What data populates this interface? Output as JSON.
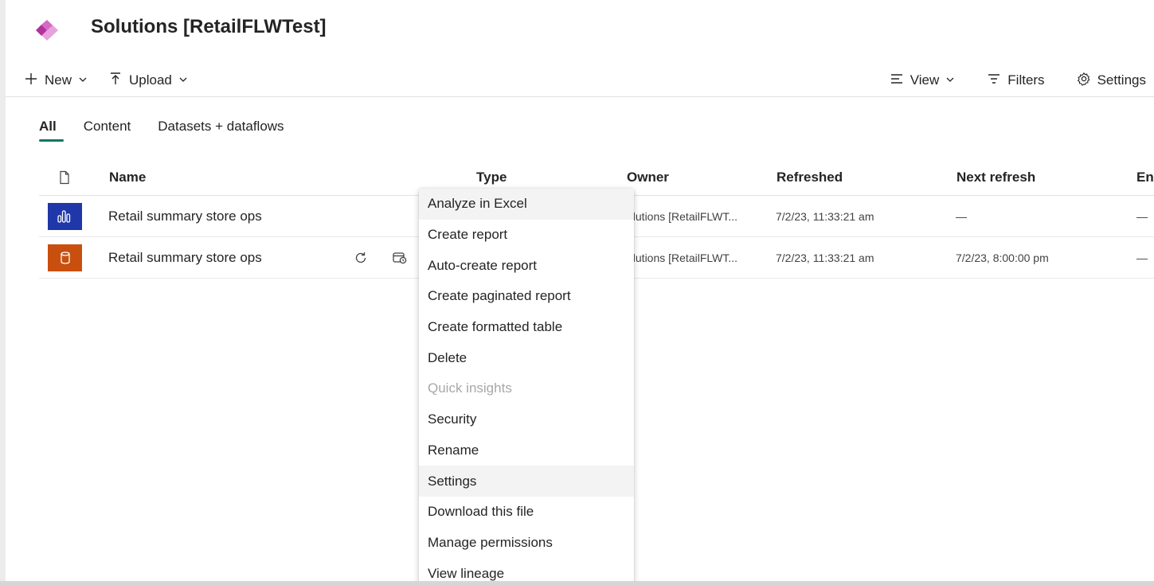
{
  "window": {
    "title": "Solutions [RetailFLWTest]"
  },
  "toolbar": {
    "new_label": "New",
    "upload_label": "Upload",
    "view_label": "View",
    "filters_label": "Filters",
    "settings_label": "Settings"
  },
  "tabs": [
    {
      "label": "All",
      "active": true
    },
    {
      "label": "Content",
      "active": false
    },
    {
      "label": "Datasets + dataflows",
      "active": false
    }
  ],
  "table": {
    "headers": {
      "name": "Name",
      "type": "Type",
      "owner": "Owner",
      "refreshed": "Refreshed",
      "next_refresh": "Next refresh",
      "endorsement": "En"
    },
    "rows": [
      {
        "icon": "report-icon",
        "icon_color": "#1f37a8",
        "name": "Retail summary store ops",
        "owner": "olutions [RetailFLWT...",
        "refreshed": "7/2/23, 11:33:21 am",
        "next_refresh": "—",
        "endorsement": "—"
      },
      {
        "icon": "dataset-icon",
        "icon_color": "#c94f0f",
        "name": "Retail summary store ops",
        "owner": "olutions [RetailFLWT...",
        "refreshed": "7/2/23, 11:33:21 am",
        "next_refresh": "7/2/23, 8:00:00 pm",
        "endorsement": "—"
      }
    ]
  },
  "context_menu": {
    "items": [
      {
        "label": "Analyze in Excel",
        "state": "hover"
      },
      {
        "label": "Create report",
        "state": "normal"
      },
      {
        "label": "Auto-create report",
        "state": "normal"
      },
      {
        "label": "Create paginated report",
        "state": "normal"
      },
      {
        "label": "Create formatted table",
        "state": "normal"
      },
      {
        "label": "Delete",
        "state": "normal"
      },
      {
        "label": "Quick insights",
        "state": "disabled"
      },
      {
        "label": "Security",
        "state": "normal"
      },
      {
        "label": "Rename",
        "state": "normal"
      },
      {
        "label": "Settings",
        "state": "hover"
      },
      {
        "label": "Download this file",
        "state": "normal"
      },
      {
        "label": "Manage permissions",
        "state": "normal"
      },
      {
        "label": "View lineage",
        "state": "normal"
      }
    ]
  },
  "colors": {
    "accent_tab": "#117865",
    "logo_primary": "#b0329c",
    "logo_secondary": "#e8a0df"
  }
}
